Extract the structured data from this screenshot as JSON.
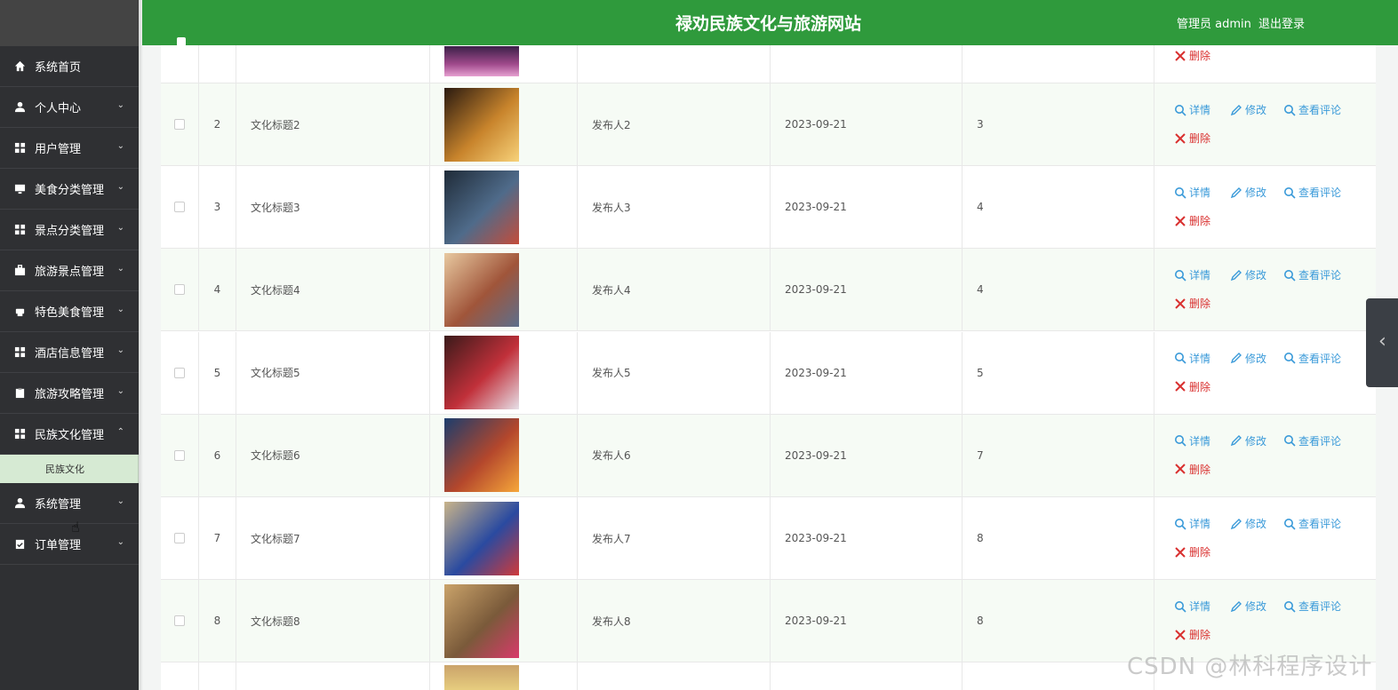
{
  "header": {
    "title": "禄劝民族文化与旅游网站",
    "user": "管理员 admin",
    "logout": "退出登录"
  },
  "sidebar": {
    "items": [
      {
        "label": "系统首页",
        "icon": "home-icon",
        "chevron": ""
      },
      {
        "label": "个人中心",
        "icon": "user-icon",
        "chevron": "⌄"
      },
      {
        "label": "用户管理",
        "icon": "grid-icon",
        "chevron": "⌄"
      },
      {
        "label": "美食分类管理",
        "icon": "monitor-icon",
        "chevron": "⌄"
      },
      {
        "label": "景点分类管理",
        "icon": "grid-icon",
        "chevron": "⌄"
      },
      {
        "label": "旅游景点管理",
        "icon": "briefcase-icon",
        "chevron": "⌄"
      },
      {
        "label": "特色美食管理",
        "icon": "printer-icon",
        "chevron": "⌄"
      },
      {
        "label": "酒店信息管理",
        "icon": "grid-icon",
        "chevron": "⌄"
      },
      {
        "label": "旅游攻略管理",
        "icon": "clipboard-icon",
        "chevron": "⌄"
      },
      {
        "label": "民族文化管理",
        "icon": "grid-icon",
        "chevron": "⌃"
      }
    ],
    "subitem": "民族文化",
    "items_after": [
      {
        "label": "系统管理",
        "icon": "user-icon",
        "chevron": "⌄"
      },
      {
        "label": "订单管理",
        "icon": "clipboard-check-icon",
        "chevron": "⌄"
      }
    ]
  },
  "table": {
    "ops": {
      "detail": "详情",
      "edit": "修改",
      "comments": "查看评论",
      "delete": "删除"
    },
    "rows": [
      {
        "num": "2",
        "title": "文化标题2",
        "publisher": "发布人2",
        "date": "2023-09-21",
        "count": "3",
        "img": [
          "#2a1a10",
          "#c8842c",
          "#f7d27a"
        ]
      },
      {
        "num": "3",
        "title": "文化标题3",
        "publisher": "发布人3",
        "date": "2023-09-21",
        "count": "4",
        "img": [
          "#1f2b38",
          "#4f6b8a",
          "#c44c3a"
        ]
      },
      {
        "num": "4",
        "title": "文化标题4",
        "publisher": "发布人4",
        "date": "2023-09-21",
        "count": "4",
        "img": [
          "#e8c9a0",
          "#a0553a",
          "#5d6f8c"
        ]
      },
      {
        "num": "5",
        "title": "文化标题5",
        "publisher": "发布人5",
        "date": "2023-09-21",
        "count": "5",
        "img": [
          "#3a1a1a",
          "#c1303a",
          "#e6e0e8"
        ]
      },
      {
        "num": "6",
        "title": "文化标题6",
        "publisher": "发布人6",
        "date": "2023-09-21",
        "count": "7",
        "img": [
          "#1b3d6d",
          "#b4472c",
          "#f6a73a"
        ]
      },
      {
        "num": "7",
        "title": "文化标题7",
        "publisher": "发布人7",
        "date": "2023-09-21",
        "count": "8",
        "img": [
          "#c9b48a",
          "#2a4aa0",
          "#d03a3a"
        ]
      },
      {
        "num": "8",
        "title": "文化标题8",
        "publisher": "发布人8",
        "date": "2023-09-21",
        "count": "8",
        "img": [
          "#caa36a",
          "#7a5a3a",
          "#d83a6a"
        ]
      }
    ]
  },
  "watermark": "CSDN @林科程序设计"
}
